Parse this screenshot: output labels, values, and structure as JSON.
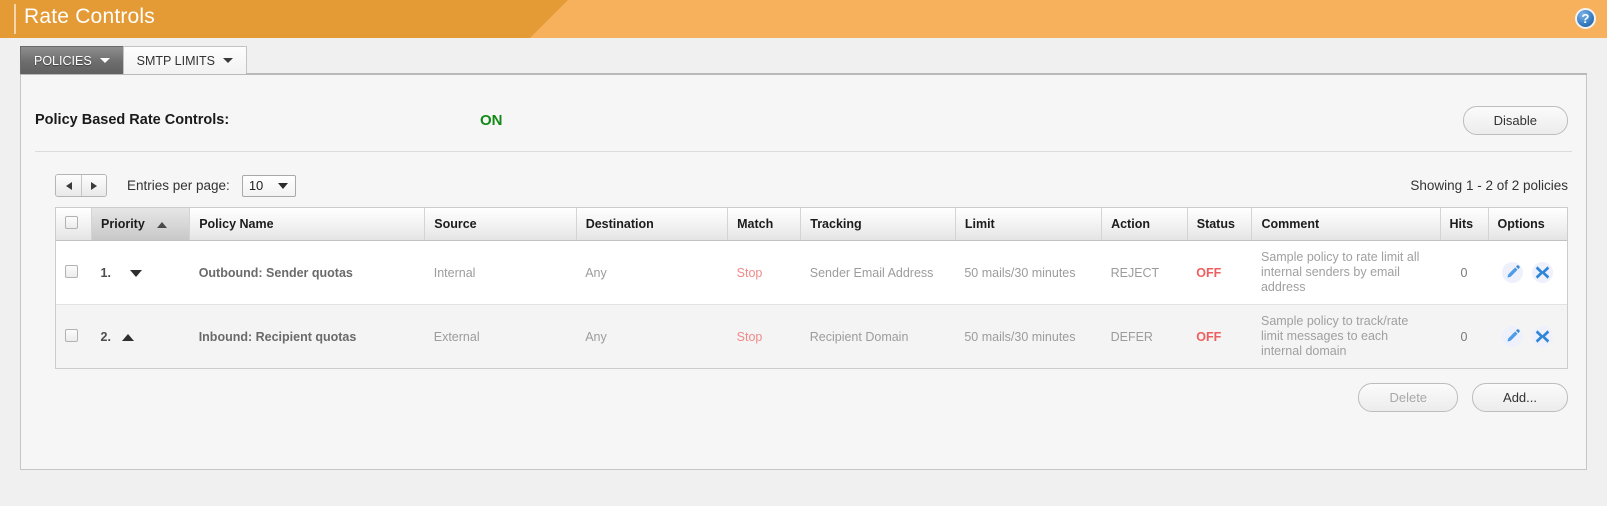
{
  "header": {
    "title": "Rate Controls",
    "help_icon": "help-circle-icon",
    "help_label": "?"
  },
  "tabs": [
    {
      "label": "POLICIES",
      "active": true
    },
    {
      "label": "SMTP LIMITS",
      "active": false
    }
  ],
  "status": {
    "label": "Policy Based Rate Controls:",
    "value": "ON",
    "value_color": "#138a17",
    "toggle_button": "Disable"
  },
  "toolbar": {
    "prev_label": "◀",
    "next_label": "▶",
    "entries_label": "Entries per page:",
    "entries_value": "10",
    "showing": "Showing 1 - 2 of 2 policies"
  },
  "table": {
    "columns": [
      "",
      "Priority",
      "Policy Name",
      "Source",
      "Destination",
      "Match",
      "Tracking",
      "Limit",
      "Action",
      "Status",
      "Comment",
      "Hits",
      "Options"
    ],
    "sorted_column": "Priority",
    "sort_direction": "asc",
    "rows": [
      {
        "priority": "1.",
        "move": "down",
        "name": "Outbound: Sender quotas",
        "source": "Internal",
        "destination": "Any",
        "match": "Stop",
        "tracking": "Sender Email Address",
        "limit": "50 mails/30 minutes",
        "action": "REJECT",
        "status": "OFF",
        "comment": "Sample policy to rate limit all internal senders by email address",
        "hits": "0",
        "edit_icon": "pencil-edit-icon",
        "delete_icon": "x-delete-icon"
      },
      {
        "priority": "2.",
        "move": "up",
        "name": "Inbound: Recipient quotas",
        "source": "External",
        "destination": "Any",
        "match": "Stop",
        "tracking": "Recipient Domain",
        "limit": "50 mails/30 minutes",
        "action": "DEFER",
        "status": "OFF",
        "comment": "Sample policy to track/rate limit messages to each internal domain",
        "hits": "0",
        "edit_icon": "pencil-edit-icon",
        "delete_icon": "x-delete-icon"
      }
    ]
  },
  "footer": {
    "delete_label": "Delete",
    "add_label": "Add..."
  }
}
